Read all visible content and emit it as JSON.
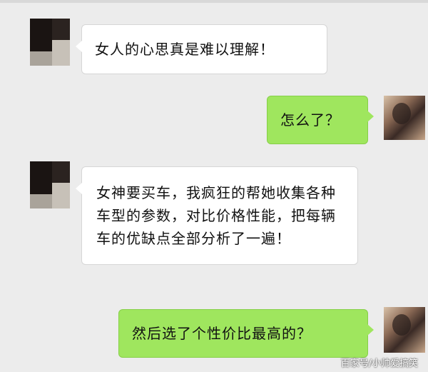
{
  "messages": [
    {
      "side": "left",
      "text": "女人的心思真是难以理解！"
    },
    {
      "side": "right",
      "text": "怎么了？"
    },
    {
      "side": "left",
      "text": "女神要买车，我疯狂的帮她收集各种车型的参数，对比价格性能，把每辆车的优缺点全部分析了一遍！"
    },
    {
      "side": "right",
      "text": "然后选了个性价比最高的？"
    }
  ],
  "watermark": "百家号/小帅爱搞笑",
  "colors": {
    "background": "#ececec",
    "left_bubble": "#ffffff",
    "right_bubble": "#9fe65e"
  }
}
